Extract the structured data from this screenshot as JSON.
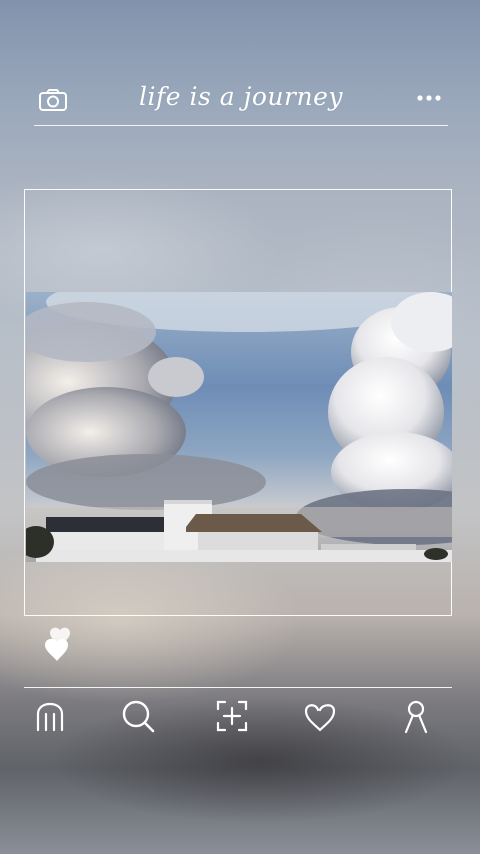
{
  "header": {
    "title": "life is a journey",
    "camera_icon": "camera-icon",
    "more_icon": "more-horizontal-icon"
  },
  "post": {
    "photo_description_icon": "photo",
    "like_icon": "hearts-icon"
  },
  "nav": {
    "items": [
      {
        "name": "home",
        "icon": "home-icon"
      },
      {
        "name": "search",
        "icon": "search-icon"
      },
      {
        "name": "add",
        "icon": "add-post-icon"
      },
      {
        "name": "favorites",
        "icon": "heart-icon"
      },
      {
        "name": "profile",
        "icon": "profile-icon"
      }
    ]
  },
  "colors": {
    "foreground": "#ffffff",
    "sky_blue": "#6f8cb3",
    "cloud_white": "#eef0f3"
  }
}
